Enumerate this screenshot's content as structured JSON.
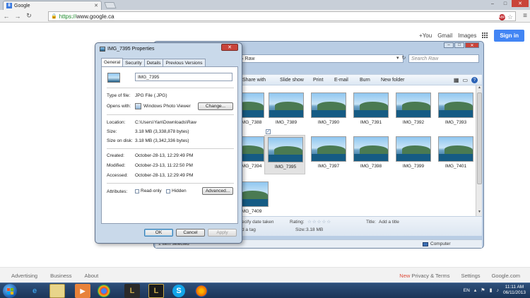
{
  "browser": {
    "tab_title": "Google",
    "url_scheme": "https://",
    "url_rest": "www.google.ca",
    "adblock_label": "ABP"
  },
  "google": {
    "plus_you": "+You",
    "gmail": "Gmail",
    "images": "Images",
    "signin": "Sign in",
    "footer_left": [
      "Advertising",
      "Business",
      "About"
    ],
    "footer_new": "New",
    "footer_privacy": "Privacy & Terms",
    "footer_settings": "Settings",
    "footer_domain": "Google.com"
  },
  "explorer": {
    "address": "Raw",
    "search_placeholder": "Search Raw",
    "toolbar": [
      "Share with",
      "Slide show",
      "Print",
      "E-mail",
      "Burn",
      "New folder"
    ],
    "thumbnails": [
      {
        "label": "IMG_7388"
      },
      {
        "label": "IMG_7389"
      },
      {
        "label": "IMG_7390"
      },
      {
        "label": "IMG_7391"
      },
      {
        "label": "IMG_7392"
      },
      {
        "label": "IMG_7393"
      },
      {
        "label": "IMG_7394"
      },
      {
        "label": "IMG_7395"
      },
      {
        "label": "IMG_7397"
      },
      {
        "label": "IMG_7398"
      },
      {
        "label": "IMG_7399"
      },
      {
        "label": "IMG_7401"
      },
      {
        "label": "IMG_7409"
      }
    ],
    "details": {
      "date": "ecify date taken",
      "tag": "d a tag",
      "rating_label": "Rating:",
      "size_label": "Size:",
      "size_value": "3.18 MB",
      "title_label": "Title:",
      "title_value": "Add a title"
    },
    "status_left": "1 item selected",
    "status_right": "Computer"
  },
  "properties": {
    "title": "IMG_7395 Properties",
    "tabs": [
      "General",
      "Security",
      "Details",
      "Previous Versions"
    ],
    "filename": "IMG_7395",
    "type_label": "Type of file:",
    "type_value": "JPG File (.JPG)",
    "opens_label": "Opens with:",
    "opens_value": "Windows Photo Viewer",
    "change_btn": "Change...",
    "location_label": "Location:",
    "location_value": "C:\\Users\\Yan\\Downloads\\Raw",
    "size_label": "Size:",
    "size_value": "3.18 MB (3,338,878 bytes)",
    "disk_label": "Size on disk:",
    "disk_value": "3.18 MB (3,342,336 bytes)",
    "created_label": "Created:",
    "created_value": "October-28-13, 12:29:49 PM",
    "modified_label": "Modified:",
    "modified_value": "October-23-13, 11:22:50 PM",
    "accessed_label": "Accessed:",
    "accessed_value": "October-28-13, 12:29:49 PM",
    "attributes_label": "Attributes:",
    "readonly_label": "Read-only",
    "hidden_label": "Hidden",
    "advanced_btn": "Advanced...",
    "ok": "OK",
    "cancel": "Cancel",
    "apply": "Apply"
  },
  "taskbar": {
    "language": "EN",
    "time": "11:11 AM",
    "date": "06/11/2013"
  }
}
